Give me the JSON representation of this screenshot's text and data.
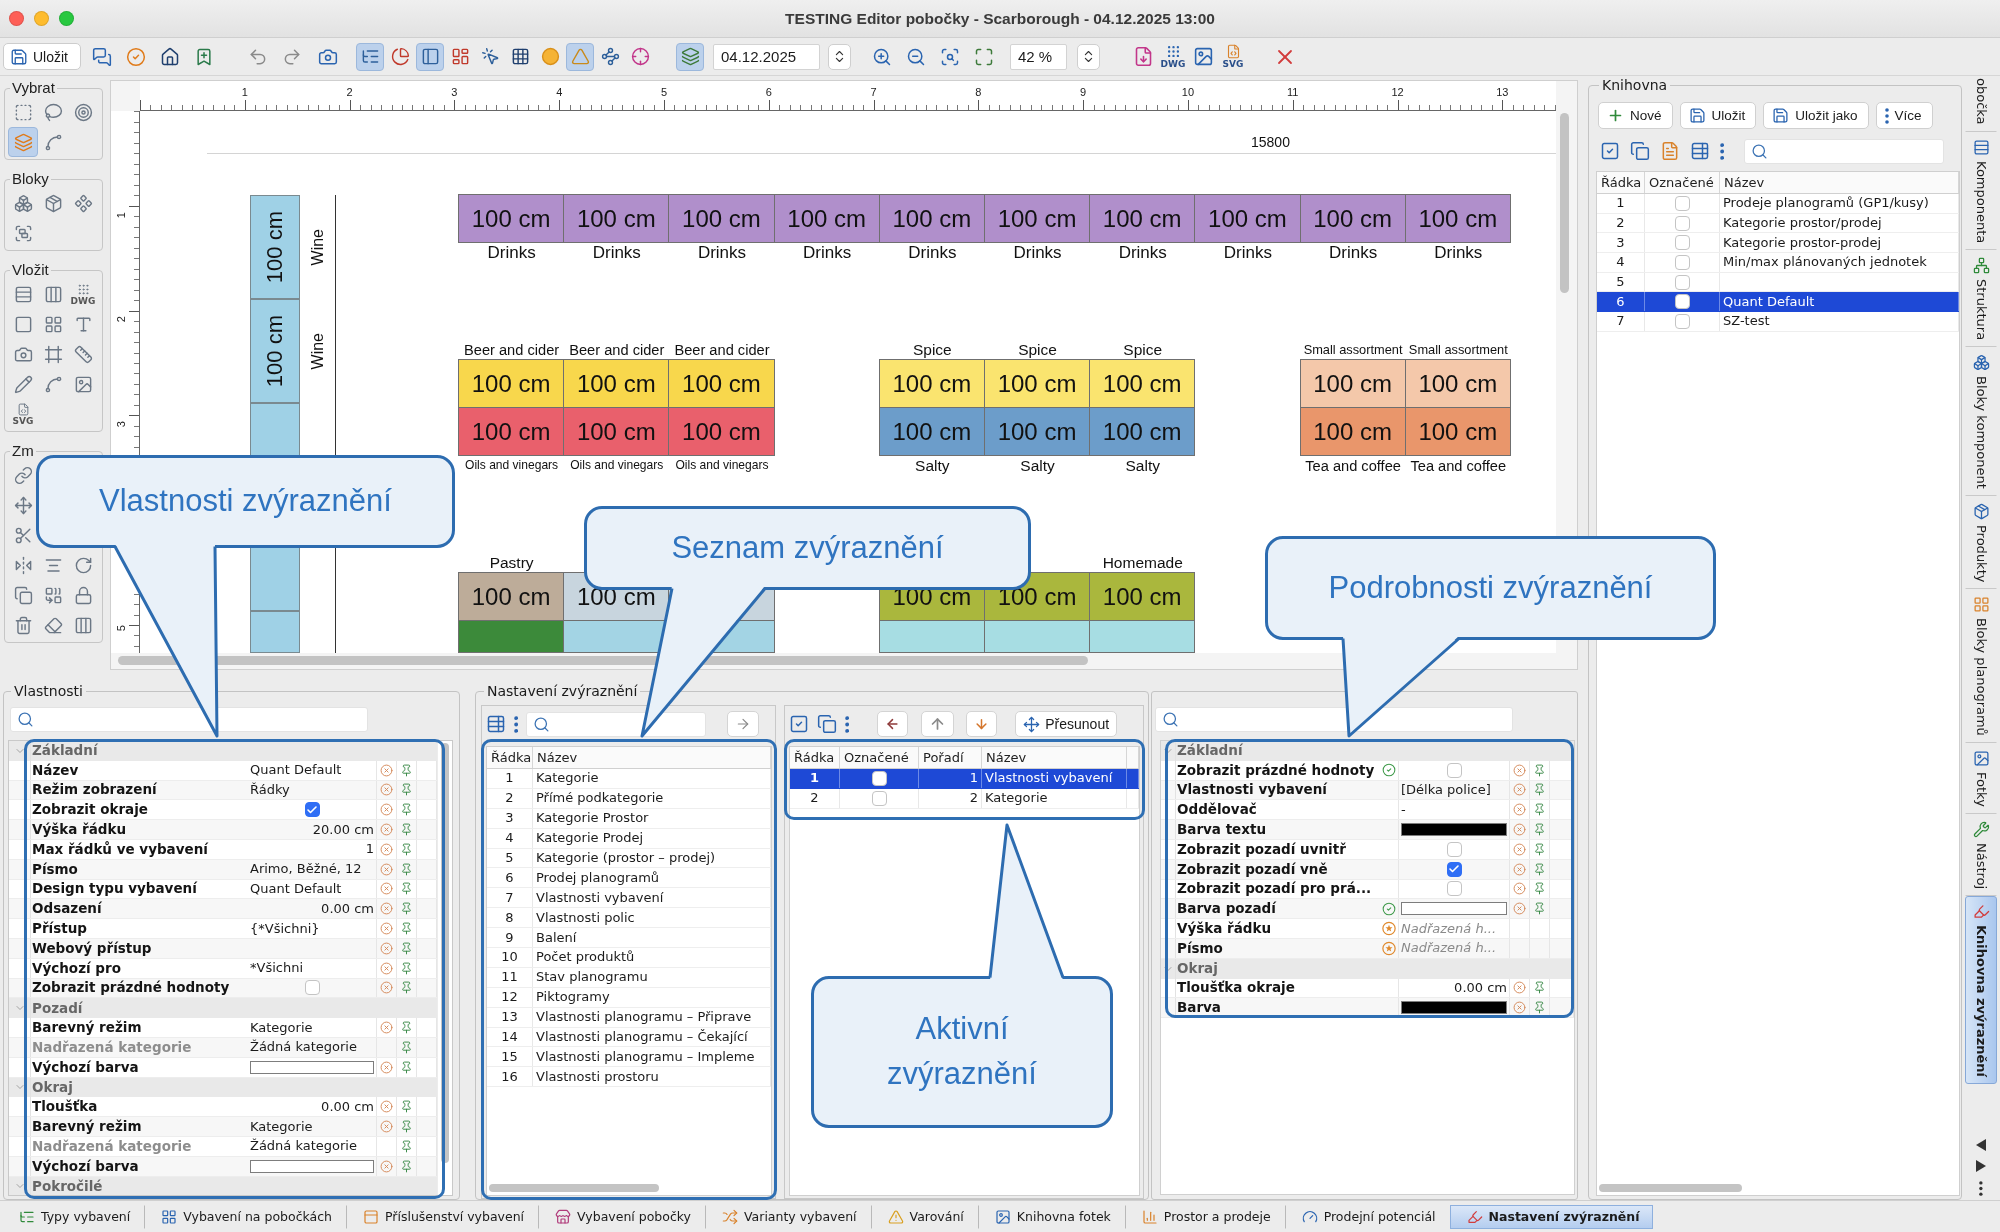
{
  "window": {
    "title": "TESTING Editor pobočky - Scarborough - 04.12.2025 13:00"
  },
  "toolbar": {
    "save_button": "Uložit",
    "view_toggles": [
      {
        "on": true
      },
      {
        "on": false
      },
      {
        "on": true
      },
      {
        "on": false
      },
      {
        "on": false
      },
      {
        "on": false
      },
      {
        "on": false
      },
      {
        "on": true
      },
      {
        "on": false
      },
      {
        "on": false
      }
    ],
    "layers_toggle": {
      "on": true
    },
    "date": "04.12.2025",
    "zoom": "42 %",
    "export_tools": [
      {
        "kind": "pdf"
      },
      {
        "kind": "dwg",
        "caption": "DWG"
      },
      {
        "kind": "image"
      },
      {
        "kind": "svg",
        "caption": "SVG"
      }
    ]
  },
  "palette": [
    {
      "title": "Vybrat",
      "rows": [
        [
          {
            "selected": false
          },
          {
            "selected": false
          },
          {
            "selected": false
          }
        ],
        [
          {
            "selected": true
          },
          {
            "selected": false
          }
        ]
      ]
    },
    {
      "title": "Bloky",
      "rows": [
        [
          {
            "selected": false
          },
          {
            "selected": false
          },
          {
            "selected": false
          }
        ],
        [
          {
            "selected": false
          }
        ]
      ]
    },
    {
      "title": "Vložit",
      "rows": [
        [
          {
            "selected": false
          },
          {
            "selected": false
          },
          {
            "selected": false,
            "caption": "DWG"
          }
        ],
        [
          {
            "selected": false
          },
          {
            "selected": false
          },
          {
            "selected": false
          }
        ],
        [
          {
            "selected": false
          },
          {
            "selected": false
          },
          {
            "selected": false
          }
        ],
        [
          {
            "selected": false
          },
          {
            "selected": false
          },
          {
            "selected": false
          }
        ],
        [
          {
            "selected": false,
            "caption": "SVG"
          }
        ]
      ]
    },
    {
      "title": "Zm",
      "rows": [
        [
          {
            "selected": false
          }
        ],
        [
          {
            "selected": false
          }
        ],
        [
          {
            "selected": false
          }
        ],
        [
          {
            "selected": false
          },
          {
            "selected": false
          },
          {
            "selected": false
          }
        ],
        [
          {
            "selected": false
          },
          {
            "selected": false
          },
          {
            "selected": false
          }
        ],
        [
          {
            "selected": false
          },
          {
            "selected": false
          },
          {
            "selected": false
          }
        ]
      ]
    }
  ],
  "canvas": {
    "ruler_marks": [
      "1",
      "2",
      "3",
      "4",
      "5",
      "6",
      "7",
      "8",
      "9",
      "10",
      "11",
      "12",
      "13"
    ],
    "side_ruler": {
      "upper_marks": [
        "1",
        "2",
        "3"
      ],
      "lower_marks": [
        "5"
      ]
    },
    "width_label": "15800",
    "side_column": [
      {
        "size": "100 cm",
        "label": "Wine",
        "color": "#9fd1e6"
      },
      {
        "size": "100 cm",
        "label": "Wine",
        "color": "#9fd1e6"
      },
      {
        "color": "#9fd1e6"
      },
      {
        "color": "#9fd1e6"
      },
      {
        "color": "#9fd1e6"
      }
    ],
    "shelf_rows": [
      {
        "groups": [
          {
            "columns": [
              {
                "cells": [
                  {
                    "size": "100 cm",
                    "color": "#b08fcb"
                  }
                ],
                "bottom_label": "Drinks"
              },
              {
                "cells": [
                  {
                    "size": "100 cm",
                    "color": "#b08fcb"
                  }
                ],
                "bottom_label": "Drinks"
              },
              {
                "cells": [
                  {
                    "size": "100 cm",
                    "color": "#b08fcb"
                  }
                ],
                "bottom_label": "Drinks"
              },
              {
                "cells": [
                  {
                    "size": "100 cm",
                    "color": "#b08fcb"
                  }
                ],
                "bottom_label": "Drinks"
              },
              {
                "cells": [
                  {
                    "size": "100 cm",
                    "color": "#b08fcb"
                  }
                ],
                "bottom_label": "Drinks"
              },
              {
                "cells": [
                  {
                    "size": "100 cm",
                    "color": "#b08fcb"
                  }
                ],
                "bottom_label": "Drinks"
              },
              {
                "cells": [
                  {
                    "size": "100 cm",
                    "color": "#b08fcb"
                  }
                ],
                "bottom_label": "Drinks"
              },
              {
                "cells": [
                  {
                    "size": "100 cm",
                    "color": "#b08fcb"
                  }
                ],
                "bottom_label": "Drinks"
              },
              {
                "cells": [
                  {
                    "size": "100 cm",
                    "color": "#b08fcb"
                  }
                ],
                "bottom_label": "Drinks"
              },
              {
                "cells": [
                  {
                    "size": "100 cm",
                    "color": "#b08fcb"
                  }
                ],
                "bottom_label": "Drinks"
              }
            ]
          }
        ]
      },
      {
        "groups": [
          {
            "columns": [
              {
                "top_label": "Beer and cider",
                "cells": [
                  {
                    "size": "100 cm",
                    "color": "#f8d74c"
                  },
                  {
                    "size": "100 cm",
                    "color": "#e9606c"
                  }
                ],
                "bottom_label": "Oils and vinegars"
              },
              {
                "top_label": "Beer and cider",
                "cells": [
                  {
                    "size": "100 cm",
                    "color": "#f8d74c"
                  },
                  {
                    "size": "100 cm",
                    "color": "#e9606c"
                  }
                ],
                "bottom_label": "Oils and vinegars"
              },
              {
                "top_label": "Beer and cider",
                "cells": [
                  {
                    "size": "100 cm",
                    "color": "#f8d74c"
                  },
                  {
                    "size": "100 cm",
                    "color": "#e9606c"
                  }
                ],
                "bottom_label": "Oils and vinegars"
              }
            ]
          },
          {
            "columns": [
              {
                "top_label": "Spice",
                "cells": [
                  {
                    "size": "100 cm",
                    "color": "#fae46f"
                  },
                  {
                    "size": "100 cm",
                    "color": "#6c9dca"
                  }
                ],
                "bottom_label": "Salty"
              },
              {
                "top_label": "Spice",
                "cells": [
                  {
                    "size": "100 cm",
                    "color": "#fae46f"
                  },
                  {
                    "size": "100 cm",
                    "color": "#6c9dca"
                  }
                ],
                "bottom_label": "Salty"
              },
              {
                "top_label": "Spice",
                "cells": [
                  {
                    "size": "100 cm",
                    "color": "#fae46f"
                  },
                  {
                    "size": "100 cm",
                    "color": "#6c9dca"
                  }
                ],
                "bottom_label": "Salty"
              }
            ]
          },
          {
            "columns": [
              {
                "top_label": "Small assortment",
                "cells": [
                  {
                    "size": "100 cm",
                    "color": "#f4c8aa"
                  },
                  {
                    "size": "100 cm",
                    "color": "#e9966b"
                  }
                ],
                "bottom_label": "Tea and coffee"
              },
              {
                "top_label": "Small assortment",
                "cells": [
                  {
                    "size": "100 cm",
                    "color": "#f4c8aa"
                  },
                  {
                    "size": "100 cm",
                    "color": "#e9966b"
                  }
                ],
                "bottom_label": "Tea and coffee"
              }
            ]
          }
        ]
      },
      {
        "groups": [
          {
            "columns": [
              {
                "top_label": "Pastry",
                "cells": [
                  {
                    "size": "100 cm",
                    "color": "#bdac99"
                  },
                  {
                    "color": "#3c8a3a"
                  }
                ]
              },
              {
                "cells": [
                  {
                    "size": "100 cm",
                    "color": "#c8d5de"
                  },
                  {
                    "color": "#a3d4e4"
                  }
                ]
              },
              {
                "cells": [
                  {
                    "color": "#c8d5de"
                  },
                  {
                    "color": "#a3d4e4"
                  }
                ]
              }
            ]
          },
          {
            "columns": [
              {
                "cells": [
                  {
                    "size": "100 cm",
                    "color": "#aab73d"
                  },
                  {
                    "color": "#a7dde3"
                  }
                ]
              },
              {
                "cells": [
                  {
                    "size": "100 cm",
                    "color": "#aab73d"
                  },
                  {
                    "color": "#a7dde3"
                  }
                ]
              },
              {
                "top_label": "Homemade",
                "cells": [
                  {
                    "size": "100 cm",
                    "color": "#aab73d"
                  },
                  {
                    "color": "#a7dde3"
                  }
                ]
              }
            ]
          }
        ]
      }
    ]
  },
  "properties_panel": {
    "title": "Vlastnosti",
    "sections": [
      {
        "title": "Základní",
        "expanded": true,
        "rows": [
          {
            "label": "Název",
            "kind": "text",
            "value": "Quant Default",
            "disabled": false
          },
          {
            "label": "Režim zobrazení",
            "kind": "text",
            "value": "Řádky",
            "disabled": false
          },
          {
            "label": "Zobrazit okraje",
            "kind": "checkbox",
            "checked": true,
            "disabled": false
          },
          {
            "label": "Výška řádku",
            "kind": "number",
            "value": "20.00 cm",
            "disabled": false
          },
          {
            "label": "Max řádků ve vybavení",
            "kind": "number",
            "value": "1",
            "disabled": false
          },
          {
            "label": "Písmo",
            "kind": "text",
            "value": "Arimo, Běžné, 12",
            "disabled": false
          },
          {
            "label": "Design typu vybavení",
            "kind": "text",
            "value": "Quant Default",
            "disabled": false
          },
          {
            "label": "Odsazení",
            "kind": "number",
            "value": "0.00 cm",
            "disabled": false
          },
          {
            "label": "Přístup",
            "kind": "text",
            "value": "{*Všichni}",
            "disabled": false
          },
          {
            "label": "Webový přístup",
            "kind": "text",
            "disabled": false
          },
          {
            "label": "Výchozí pro",
            "kind": "text",
            "value": "*Všichni",
            "disabled": false
          },
          {
            "label": "Zobrazit prázdné hodnoty",
            "kind": "checkbox",
            "checked": false,
            "disabled": false
          }
        ]
      },
      {
        "title": "Pozadí",
        "expanded": true,
        "rows": [
          {
            "label": "Barevný režim",
            "kind": "text",
            "value": "Kategorie",
            "disabled": false
          },
          {
            "label": "Nadřazená kategorie",
            "kind": "text",
            "value": "Žádná kategorie",
            "disabled": true
          },
          {
            "label": "Výchozí barva",
            "kind": "color",
            "color": "#ffffff",
            "disabled": false
          }
        ]
      },
      {
        "title": "Okraj",
        "expanded": true,
        "rows": [
          {
            "label": "Tloušťka",
            "kind": "number",
            "value": "0.00 cm",
            "disabled": false
          },
          {
            "label": "Barevný režim",
            "kind": "text",
            "value": "Kategorie",
            "disabled": false
          },
          {
            "label": "Nadřazená kategorie",
            "kind": "text",
            "value": "Žádná kategorie",
            "disabled": true
          },
          {
            "label": "Výchozí barva",
            "kind": "color",
            "color": "#ffffff",
            "disabled": false
          }
        ]
      },
      {
        "title": "Pokročilé",
        "expanded": true
      }
    ]
  },
  "highlight_settings": {
    "title": "Nastavení zvýraznění",
    "library": {
      "columns": [
        "Řádka",
        "Název"
      ],
      "rows": [
        {
          "number": "1",
          "name": "Kategorie"
        },
        {
          "number": "2",
          "name": "Přímé podkategorie"
        },
        {
          "number": "3",
          "name": "Kategorie Prostor"
        },
        {
          "number": "4",
          "name": "Kategorie Prodej"
        },
        {
          "number": "5",
          "name": "Kategorie (prostor – prodej)"
        },
        {
          "number": "6",
          "name": "Prodej planogramů"
        },
        {
          "number": "7",
          "name": "Vlastnosti vybavení"
        },
        {
          "number": "8",
          "name": "Vlastnosti polic"
        },
        {
          "number": "9",
          "name": "Balení"
        },
        {
          "number": "10",
          "name": "Počet produktů"
        },
        {
          "number": "11",
          "name": "Stav planogramu"
        },
        {
          "number": "12",
          "name": "Piktogramy"
        },
        {
          "number": "13",
          "name": "Vlastnosti planogramu – Připrave"
        },
        {
          "number": "14",
          "name": "Vlastnosti planogramu – Čekající"
        },
        {
          "number": "15",
          "name": "Vlastnosti planogramu – Impleme"
        },
        {
          "number": "16",
          "name": "Vlastnosti prostoru"
        }
      ]
    },
    "active": {
      "move_button": "Přesunout",
      "columns": [
        "Řádka",
        "Označené",
        "Pořadí",
        "Název"
      ],
      "rows": [
        {
          "number": "1",
          "checked": false,
          "order": "1",
          "name": "Vlastnosti vybavení",
          "selected": true
        },
        {
          "number": "2",
          "checked": false,
          "order": "2",
          "name": "Kategorie",
          "selected": false
        }
      ]
    }
  },
  "details_panel": {
    "sections": [
      {
        "title": "Základní",
        "expanded": true,
        "rows": [
          {
            "label": "Zobrazit prázdné hodnoty",
            "indicator": {
              "kind": "set"
            },
            "kind": "checkbox",
            "checked": false
          },
          {
            "label": "Vlastnosti vybavení",
            "kind": "text",
            "value": "[Délka police]"
          },
          {
            "label": "Oddělovač",
            "kind": "text",
            "value": "-"
          },
          {
            "label": "Barva textu",
            "kind": "color",
            "color": "#000000"
          },
          {
            "label": "Zobrazit pozadí uvnitř",
            "kind": "checkbox",
            "checked": false
          },
          {
            "label": "Zobrazit pozadí vně",
            "kind": "checkbox",
            "checked": true
          },
          {
            "label": "Zobrazit pozadí pro prá...",
            "kind": "checkbox",
            "checked": false
          },
          {
            "label": "Barva pozadí",
            "indicator": {
              "kind": "set"
            },
            "kind": "color",
            "color": "#ffffff"
          },
          {
            "label": "Výška řádku",
            "indicator": {
              "kind": "inherited"
            },
            "kind": "inherited",
            "value": "Nadřazená h..."
          },
          {
            "label": "Písmo",
            "indicator": {
              "kind": "inherited"
            },
            "kind": "inherited",
            "value": "Nadřazená h..."
          }
        ]
      },
      {
        "title": "Okraj",
        "expanded": true,
        "rows": [
          {
            "label": "Tloušťka okraje",
            "kind": "number",
            "value": "0.00 cm"
          },
          {
            "label": "Barva",
            "kind": "color",
            "color": "#000000"
          }
        ]
      }
    ]
  },
  "library_panel": {
    "title": "Knihovna",
    "buttons": [
      {
        "kind": "new",
        "label": "Nové"
      },
      {
        "kind": "save",
        "label": "Uložit"
      },
      {
        "kind": "save_as",
        "label": "Uložit jako"
      },
      {
        "kind": "more",
        "label": "Více"
      }
    ],
    "columns": [
      "Řádka",
      "Označené",
      "Název"
    ],
    "rows": [
      {
        "number": "1",
        "checked": false,
        "name": "Prodeje planogramů (GP1/kusy)",
        "selected": false
      },
      {
        "number": "2",
        "checked": false,
        "name": "Kategorie prostor/prodej",
        "selected": false
      },
      {
        "number": "3",
        "checked": false,
        "name": "Kategorie prostor-prodej",
        "selected": false
      },
      {
        "number": "4",
        "checked": false,
        "name": "Min/max plánovaných jednotek",
        "selected": false
      },
      {
        "number": "5",
        "checked": false,
        "selected": false
      },
      {
        "number": "6",
        "checked": false,
        "name": "Quant Default",
        "selected": true
      },
      {
        "number": "7",
        "checked": false,
        "name": "SZ-test",
        "selected": false
      }
    ]
  },
  "side_tabs": [
    {
      "label": "obočka",
      "selected": false
    },
    {
      "label": "Komponenta",
      "selected": false
    },
    {
      "label": "Struktura",
      "selected": false
    },
    {
      "label": "Bloky komponent",
      "selected": false
    },
    {
      "label": "Produkty",
      "selected": false
    },
    {
      "label": "Bloky planogramů",
      "selected": false
    },
    {
      "label": "Fotky",
      "selected": false
    },
    {
      "label": "Nástroj",
      "selected": false
    },
    {
      "label": "Knihovna zvýraznění",
      "selected": true
    }
  ],
  "bottom_tabs": [
    {
      "label": "Typy vybavení",
      "selected": false
    },
    {
      "label": "Vybavení na pobočkách",
      "selected": false
    },
    {
      "label": "Příslušenství vybavení",
      "selected": false
    },
    {
      "label": "Vybavení pobočky",
      "selected": false
    },
    {
      "label": "Varianty vybavení",
      "selected": false
    },
    {
      "label": "Varování",
      "selected": false
    },
    {
      "label": "Knihovna fotek",
      "selected": false
    },
    {
      "label": "Prostor a prodeje",
      "selected": false
    },
    {
      "label": "Prodejní potenciál",
      "selected": false
    },
    {
      "label": "Nastavení zvýraznění",
      "selected": true
    }
  ],
  "callouts": [
    {
      "text": "Vlastnosti zvýraznění"
    },
    {
      "text": "Seznam zvýraznění"
    },
    {
      "text": "Podrobnosti zvýraznění"
    },
    {
      "text": "Aktivní zvýraznění"
    }
  ]
}
